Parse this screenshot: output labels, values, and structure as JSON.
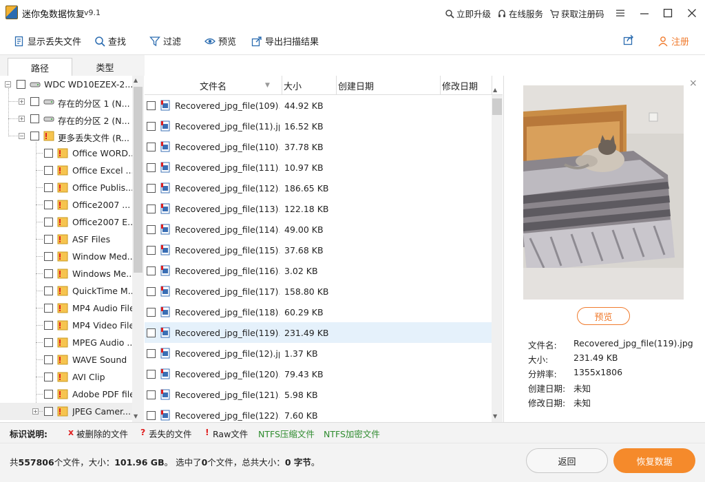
{
  "app": {
    "title": "迷你兔数据恢复",
    "version": "v9.1"
  },
  "title_links": {
    "upgrade": "立即升级",
    "online": "在线服务",
    "regcode": "获取注册码"
  },
  "toolbar": {
    "show_lost": "显示丢失文件",
    "find": "查找",
    "filter": "过滤",
    "preview": "预览",
    "export": "导出扫描结果",
    "register": "注册"
  },
  "tabs": {
    "path": "路径",
    "type": "类型"
  },
  "tree": {
    "root": "WDC WD10EZEX-2...",
    "part1": "存在的分区 1 (N...",
    "part2": "存在的分区 2 (N...",
    "more_lost": "更多丢失文件 (R...",
    "types": [
      "Office WORD...",
      "Office Excel ...",
      "Office Publis...",
      "Office2007 ...",
      "Office2007 E...",
      "ASF Files",
      "Window Med...",
      "Windows Me...",
      "QuickTime M...",
      "MP4 Audio File",
      "MP4 Video File",
      "MPEG Audio ...",
      "WAVE Sound",
      "AVI Clip",
      "Adobe PDF file",
      "JPEG Camer..."
    ]
  },
  "columns": {
    "name": "文件名",
    "size": "大小",
    "created": "创建日期",
    "modified": "修改日期"
  },
  "files": [
    {
      "name": "Recovered_jpg_file(109)....",
      "size": "44.92 KB"
    },
    {
      "name": "Recovered_jpg_file(11).jpg",
      "size": "16.52 KB"
    },
    {
      "name": "Recovered_jpg_file(110).j...",
      "size": "37.78 KB"
    },
    {
      "name": "Recovered_jpg_file(111).jpg",
      "size": "10.97 KB"
    },
    {
      "name": "Recovered_jpg_file(112).j...",
      "size": "186.65 KB"
    },
    {
      "name": "Recovered_jpg_file(113).j...",
      "size": "122.18 KB"
    },
    {
      "name": "Recovered_jpg_file(114).j...",
      "size": "49.00 KB"
    },
    {
      "name": "Recovered_jpg_file(115).j...",
      "size": "37.68 KB"
    },
    {
      "name": "Recovered_jpg_file(116).j...",
      "size": "3.02 KB"
    },
    {
      "name": "Recovered_jpg_file(117).j...",
      "size": "158.80 KB"
    },
    {
      "name": "Recovered_jpg_file(118).j...",
      "size": "60.29 KB"
    },
    {
      "name": "Recovered_jpg_file(119).j...",
      "size": "231.49 KB"
    },
    {
      "name": "Recovered_jpg_file(12).jpg",
      "size": "1.37 KB"
    },
    {
      "name": "Recovered_jpg_file(120)....",
      "size": "79.43 KB"
    },
    {
      "name": "Recovered_jpg_file(121)....",
      "size": "5.98 KB"
    },
    {
      "name": "Recovered_jpg_file(122)....",
      "size": "7.60 KB"
    }
  ],
  "preview": {
    "button": "预览",
    "labels": {
      "filename": "文件名:",
      "size": "大小:",
      "resolution": "分辨率:",
      "created": "创建日期:",
      "modified": "修改日期:"
    },
    "values": {
      "filename": "Recovered_jpg_file(119).jpg",
      "size": "231.49 KB",
      "resolution": "1355x1806",
      "created": "未知",
      "modified": "未知"
    }
  },
  "legend": {
    "title": "标识说明:",
    "deleted": "被删除的文件",
    "lost": "丢失的文件",
    "raw": "Raw文件",
    "ntfs_comp": "NTFS压缩文件",
    "ntfs_enc": "NTFS加密文件",
    "deleted_mark": "x",
    "lost_mark": "?",
    "raw_mark": "!"
  },
  "status": {
    "prefix": "共",
    "count": "557806",
    "mid": "个文件，大小：",
    "size": "101.96 GB",
    "sel1": "。 选中了",
    "sel_count": "0",
    "sel2": "个文件，总共大小：",
    "sel_size": "0 字节",
    "end": "。"
  },
  "buttons": {
    "back": "返回",
    "recover": "恢复数据"
  },
  "colors": {
    "accent": "#f58a2b",
    "ntfs": "#2e8b2e",
    "mark_red": "#e02020"
  }
}
